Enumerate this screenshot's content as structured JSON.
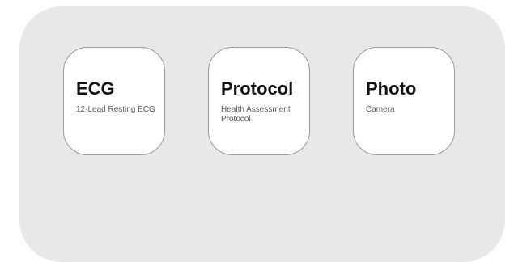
{
  "tiles": [
    {
      "title": "ECG",
      "subtitle": "12-Lead Resting ECG"
    },
    {
      "title": "Protocol",
      "subtitle": "Health Assessment Protocol"
    },
    {
      "title": "Photo",
      "subtitle": "Camera"
    }
  ],
  "colors": {
    "panel_background": "#e8e8e8",
    "tile_background": "#ffffff",
    "tile_border": "#9a9a9a",
    "title_text": "#111111",
    "subtitle_text": "#5a5a5a"
  }
}
